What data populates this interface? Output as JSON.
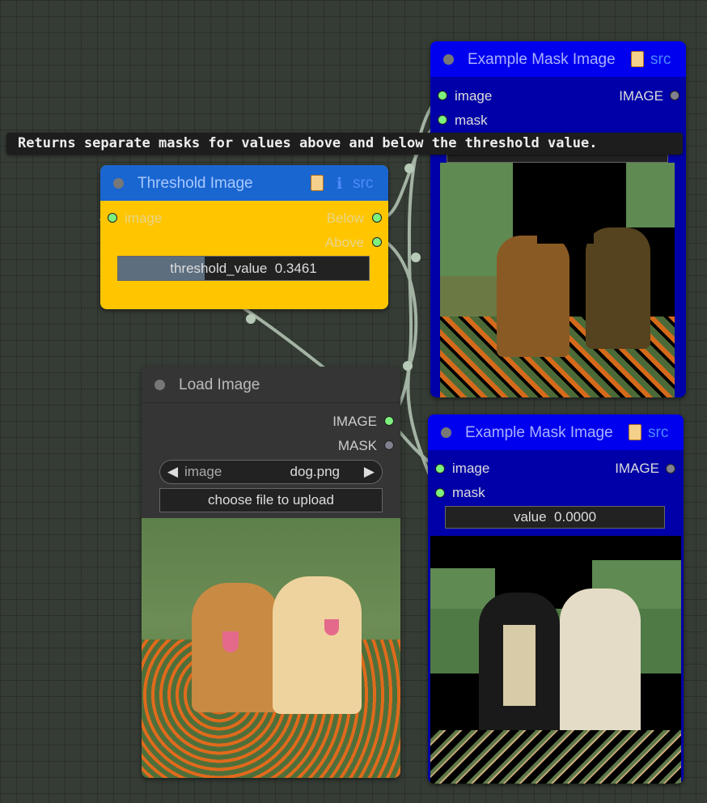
{
  "tooltip": "Returns separate masks for values above and below the threshold value.",
  "threshold_node": {
    "title": "Threshold Image",
    "badge_info": "ℹ",
    "badge_src": "src",
    "input_image": "image",
    "output_below": "Below",
    "output_above": "Above",
    "widget_label": "threshold_value",
    "widget_value": "0.3461",
    "slider_fraction": 0.3461,
    "colors": {
      "header": "#1a66d0",
      "body": "#ffc600"
    }
  },
  "mask_node_top": {
    "title": "Example Mask Image",
    "badge_src": "src",
    "input_image": "image",
    "input_mask": "mask",
    "output_image": "IMAGE",
    "colors": {
      "header": "#0000ee",
      "body": "#0000a8"
    }
  },
  "mask_node_bottom": {
    "title": "Example Mask Image",
    "badge_src": "src",
    "input_image": "image",
    "input_mask": "mask",
    "output_image": "IMAGE",
    "widget_label": "value",
    "widget_value": "0.0000",
    "colors": {
      "header": "#0000ee",
      "body": "#0000a8"
    }
  },
  "load_image_node": {
    "title": "Load Image",
    "output_image": "IMAGE",
    "output_mask": "MASK",
    "combo_label": "image",
    "combo_value": "dog.png",
    "upload_label": "choose file to upload",
    "colors": {
      "header": "#353535",
      "body": "#353535"
    }
  },
  "icons": [
    "scroll-icon",
    "info-icon",
    "arrow-left-icon",
    "arrow-right-icon"
  ]
}
